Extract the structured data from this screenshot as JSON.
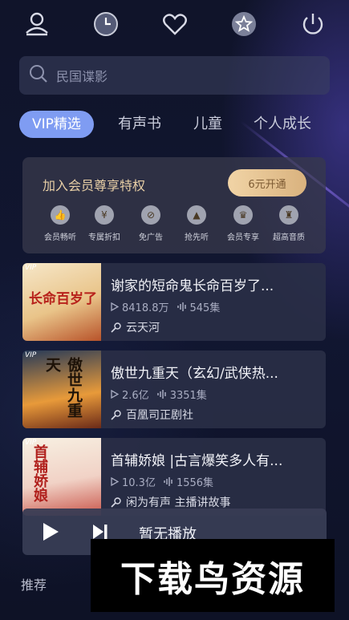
{
  "search": {
    "placeholder": "民国谍影"
  },
  "tabs": [
    {
      "label": "VIP精选",
      "active": true
    },
    {
      "label": "有声书",
      "active": false
    },
    {
      "label": "儿童",
      "active": false
    },
    {
      "label": "个人成长",
      "active": false
    }
  ],
  "vip_card": {
    "title": "加入会员尊享特权",
    "button": "6元开通",
    "perks": [
      {
        "label": "会员畅听",
        "icon": "thumbs-up-icon"
      },
      {
        "label": "专属折扣",
        "icon": "discount-tag-icon"
      },
      {
        "label": "免广告",
        "icon": "no-ads-icon"
      },
      {
        "label": "抢先听",
        "icon": "early-access-icon"
      },
      {
        "label": "会员专享",
        "icon": "member-exclusive-icon"
      },
      {
        "label": "超高音质",
        "icon": "trophy-icon"
      }
    ]
  },
  "books": [
    {
      "title": "谢家的短命鬼长命百岁了...",
      "plays": "8418.8万",
      "episodes": "545集",
      "author": "云天河",
      "badge": "VIP",
      "cover_text": "长命百岁了"
    },
    {
      "title": "傲世九重天（玄幻/武侠热...",
      "plays": "2.6亿",
      "episodes": "3351集",
      "author": "百凰司正剧社",
      "badge": "VIP",
      "cover_text": "傲世九重天"
    },
    {
      "title": "首辅娇娘 |古言爆笑多人有...",
      "plays": "10.3亿",
      "episodes": "1556集",
      "author": "闲为有声 主播讲故事",
      "badge": "VIP",
      "cover_text": "首辅娇娘"
    }
  ],
  "player": {
    "status": "暂无播放"
  },
  "bottom_nav": {
    "first": "推荐"
  },
  "watermark": "下载鸟资源",
  "colors": {
    "accent": "#7f9cf2",
    "gold": "#e8cfa6",
    "background": "#10142a"
  }
}
